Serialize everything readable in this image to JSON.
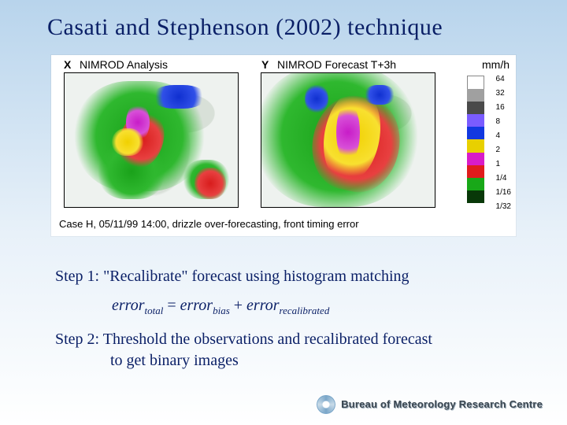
{
  "title": "Casati and Stephenson (2002) technique",
  "figure": {
    "panelX": {
      "letter": "X",
      "label": "NIMROD Analysis"
    },
    "panelY": {
      "letter": "Y",
      "label": "NIMROD Forecast T+3h"
    },
    "units": "mm/h",
    "caption": "Case H,  05/11/99 14:00, drizzle over-forecasting, front timing error",
    "colorbar": {
      "ticks": [
        "64",
        "32",
        "16",
        "8",
        "4",
        "2",
        "1",
        "1/4",
        "1/16",
        "1/32"
      ],
      "colors": [
        "#ffffff",
        "#a0a0a0",
        "#4a4a4a",
        "#7a5cff",
        "#1238e0",
        "#e8d000",
        "#d81cc8",
        "#e01c1c",
        "#18a818",
        "#083808"
      ]
    }
  },
  "steps": {
    "s1": "Step 1: \"Recalibrate\" forecast using histogram matching",
    "eq_err": "error",
    "sub_total": "total",
    "sub_bias": "bias",
    "sub_recal": "recalibrated",
    "s2a": "Step 2: Threshold the observations and recalibrated forecast",
    "s2b": "to get binary images"
  },
  "footer": "Bureau of Meteorology Research Centre"
}
